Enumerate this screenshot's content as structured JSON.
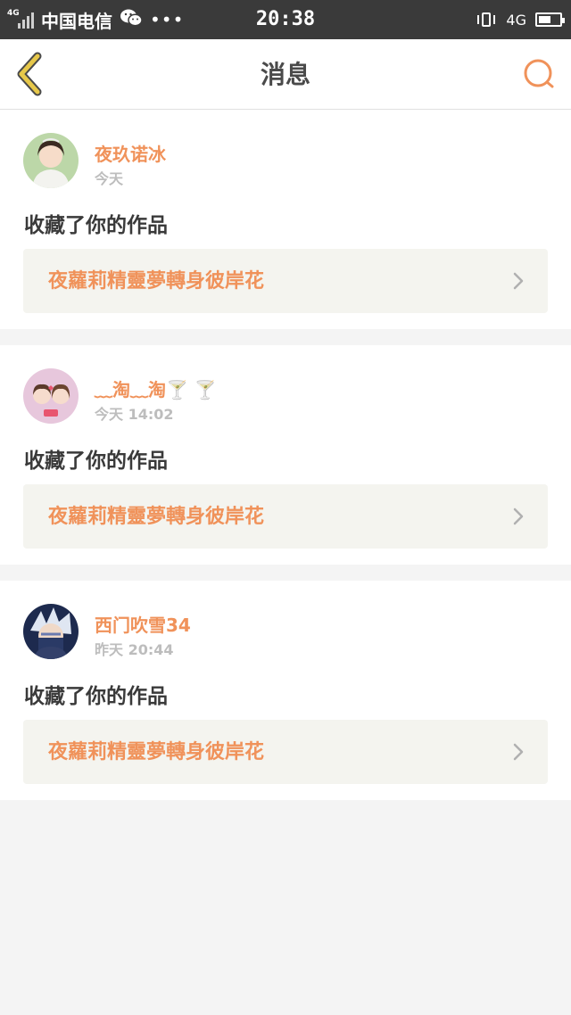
{
  "status_bar": {
    "network_tag": "4G",
    "carrier": "中国电信",
    "time": "20:38",
    "network_type": "4G",
    "battery_level": 0.6
  },
  "nav": {
    "title": "消息"
  },
  "colors": {
    "accent": "#f0925a",
    "back_icon": "#e7c84a",
    "nav_title": "#4a4a4a",
    "background": "#f4f4f4"
  },
  "messages": [
    {
      "user": "夜玖诺冰",
      "time": "今天",
      "action": "收藏了你的作品",
      "work_title": "夜蘿莉精靈夢轉身彼岸花"
    },
    {
      "user": "﹏淘﹏淘🍸 🍸",
      "time": "今天  14:02",
      "action": "收藏了你的作品",
      "work_title": "夜蘿莉精靈夢轉身彼岸花"
    },
    {
      "user": "西门吹雪34",
      "time": "昨天  20:44",
      "action": "收藏了你的作品",
      "work_title": "夜蘿莉精靈夢轉身彼岸花"
    }
  ]
}
